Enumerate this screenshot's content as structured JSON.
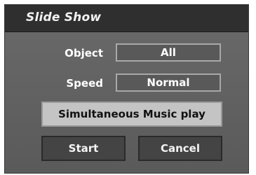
{
  "dialog": {
    "title": "Slide Show",
    "object_label": "Object",
    "object_value": "All",
    "speed_label": "Speed",
    "speed_value": "Normal",
    "music_button": "Simultaneous Music play",
    "start_button": "Start",
    "cancel_button": "Cancel"
  }
}
